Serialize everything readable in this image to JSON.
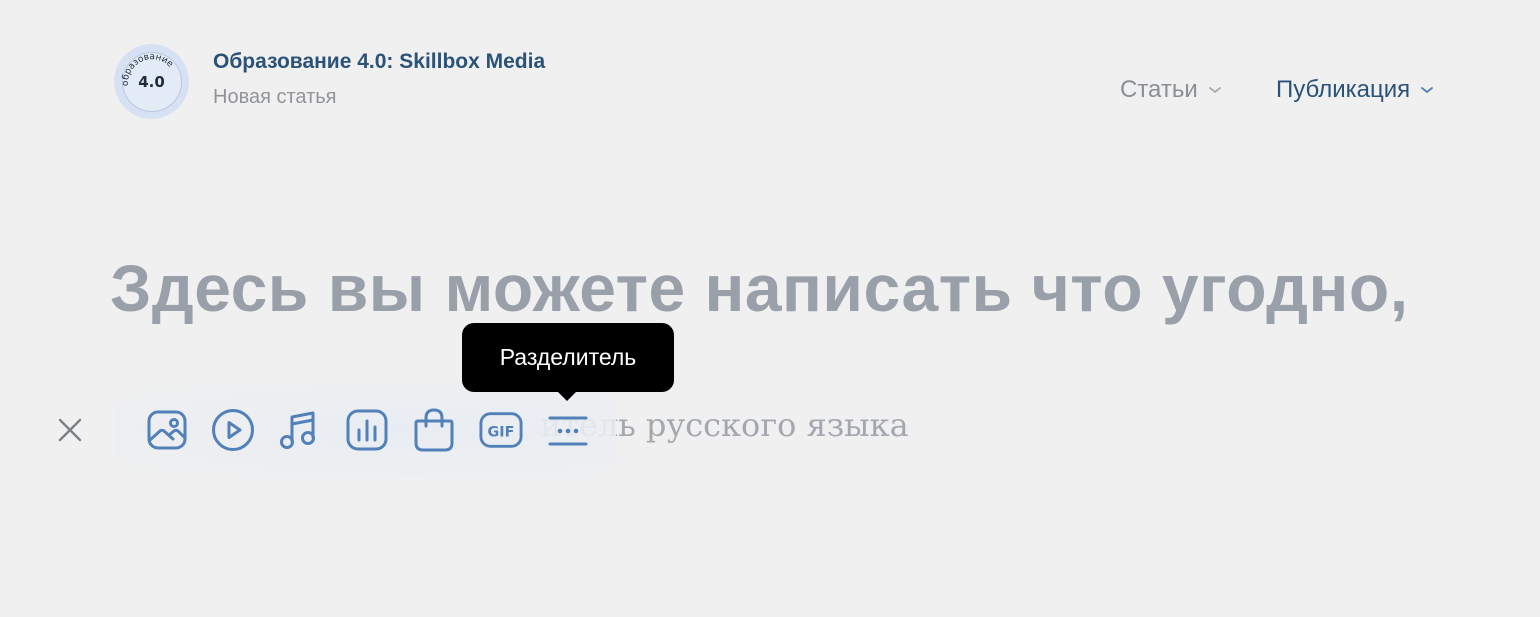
{
  "header": {
    "avatar": {
      "ring_text": "образование",
      "number": "4.0"
    },
    "group_name": "Образование 4.0: Skillbox Media",
    "subtitle": "Новая статья",
    "menu": {
      "articles_label": "Статьи",
      "publish_label": "Публикация"
    }
  },
  "editor": {
    "title_placeholder": "Здесь вы можете написать что угодно,",
    "body_placeholder": "итель русского языка"
  },
  "toolbar": {
    "accent_color": "#5181b8",
    "close_icon": "close-icon",
    "tools": [
      {
        "name": "photo",
        "icon": "image-icon"
      },
      {
        "name": "video",
        "icon": "play-icon"
      },
      {
        "name": "music",
        "icon": "music-icon"
      },
      {
        "name": "poll",
        "icon": "chart-icon"
      },
      {
        "name": "product",
        "icon": "shopping-bag-icon"
      },
      {
        "name": "gif",
        "icon": "gif-icon",
        "label": "GIF"
      },
      {
        "name": "separator",
        "icon": "separator-icon"
      }
    ]
  },
  "tooltip": {
    "text": "Разделитель"
  }
}
